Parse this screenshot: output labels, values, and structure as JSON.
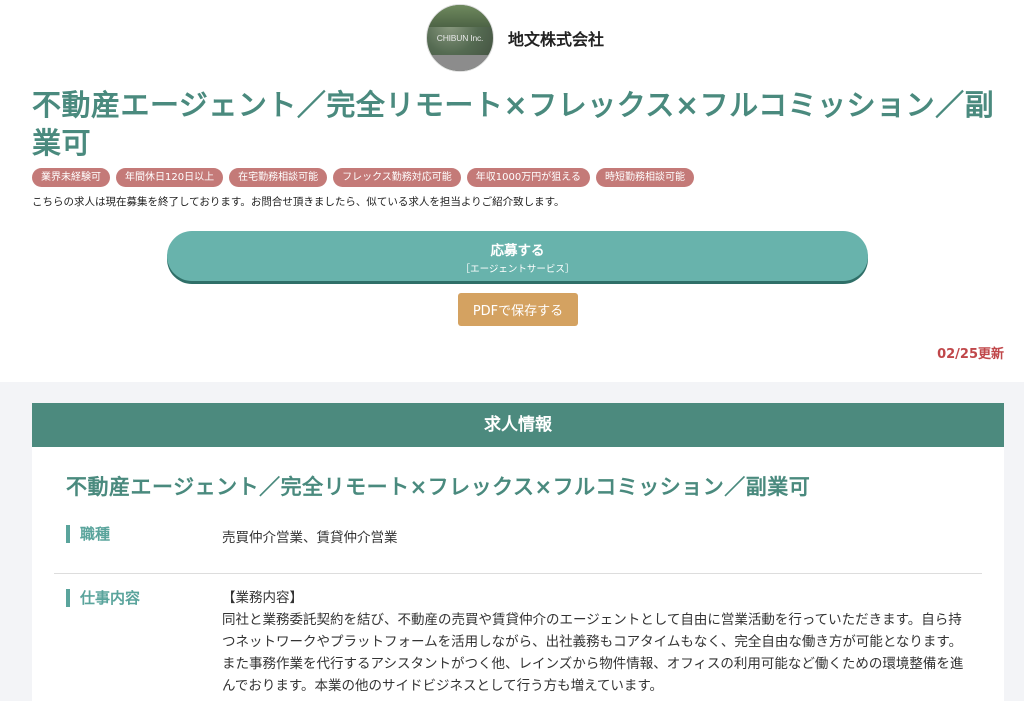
{
  "company": {
    "logo_text": "CHIBUN Inc.",
    "name": "地文株式会社"
  },
  "job": {
    "title": "不動産エージェント／完全リモート×フレックス×フルコミッション／副業可",
    "tags": [
      "業界未経験可",
      "年間休日120日以上",
      "在宅勤務相談可能",
      "フレックス勤務対応可能",
      "年収1000万円が狙える",
      "時短勤務相談可能"
    ],
    "notice": "こちらの求人は現在募集を終了しております。お問合せ頂きましたら、似ている求人を担当よりご紹介致します。"
  },
  "actions": {
    "apply_label": "応募する",
    "apply_sub": "［エージェントサービス］",
    "pdf_label": "PDFで保存する"
  },
  "updated": "02/25更新",
  "info": {
    "header": "求人情報",
    "title": "不動産エージェント／完全リモート×フレックス×フルコミッション／副業可",
    "rows": [
      {
        "label": "職種",
        "value": "売買仲介営業、賃貸仲介営業"
      },
      {
        "label": "仕事内容",
        "head": "【業務内容】",
        "body": "同社と業務委託契約を結び、不動産の売買や賃貸仲介のエージェントとして自由に営業活動を行っていただきます。自ら持つネットワークやプラットフォームを活用しながら、出社義務もコアタイムもなく、完全自由な働き方が可能となります。また事務作業を代行するアシスタントがつく他、レインズから物件情報、オフィスの利用可能など働くための環境整備を進んでおります。本業の他のサイドビジネスとして行う方も増えています。"
      }
    ]
  },
  "colors": {
    "accent_green": "#4c8a7e",
    "title_green": "#4a8a7e",
    "apply_button": "#68b3ac",
    "tag_red": "#c47a78",
    "pdf_button": "#d4a261",
    "updated_red": "#c0474a"
  }
}
